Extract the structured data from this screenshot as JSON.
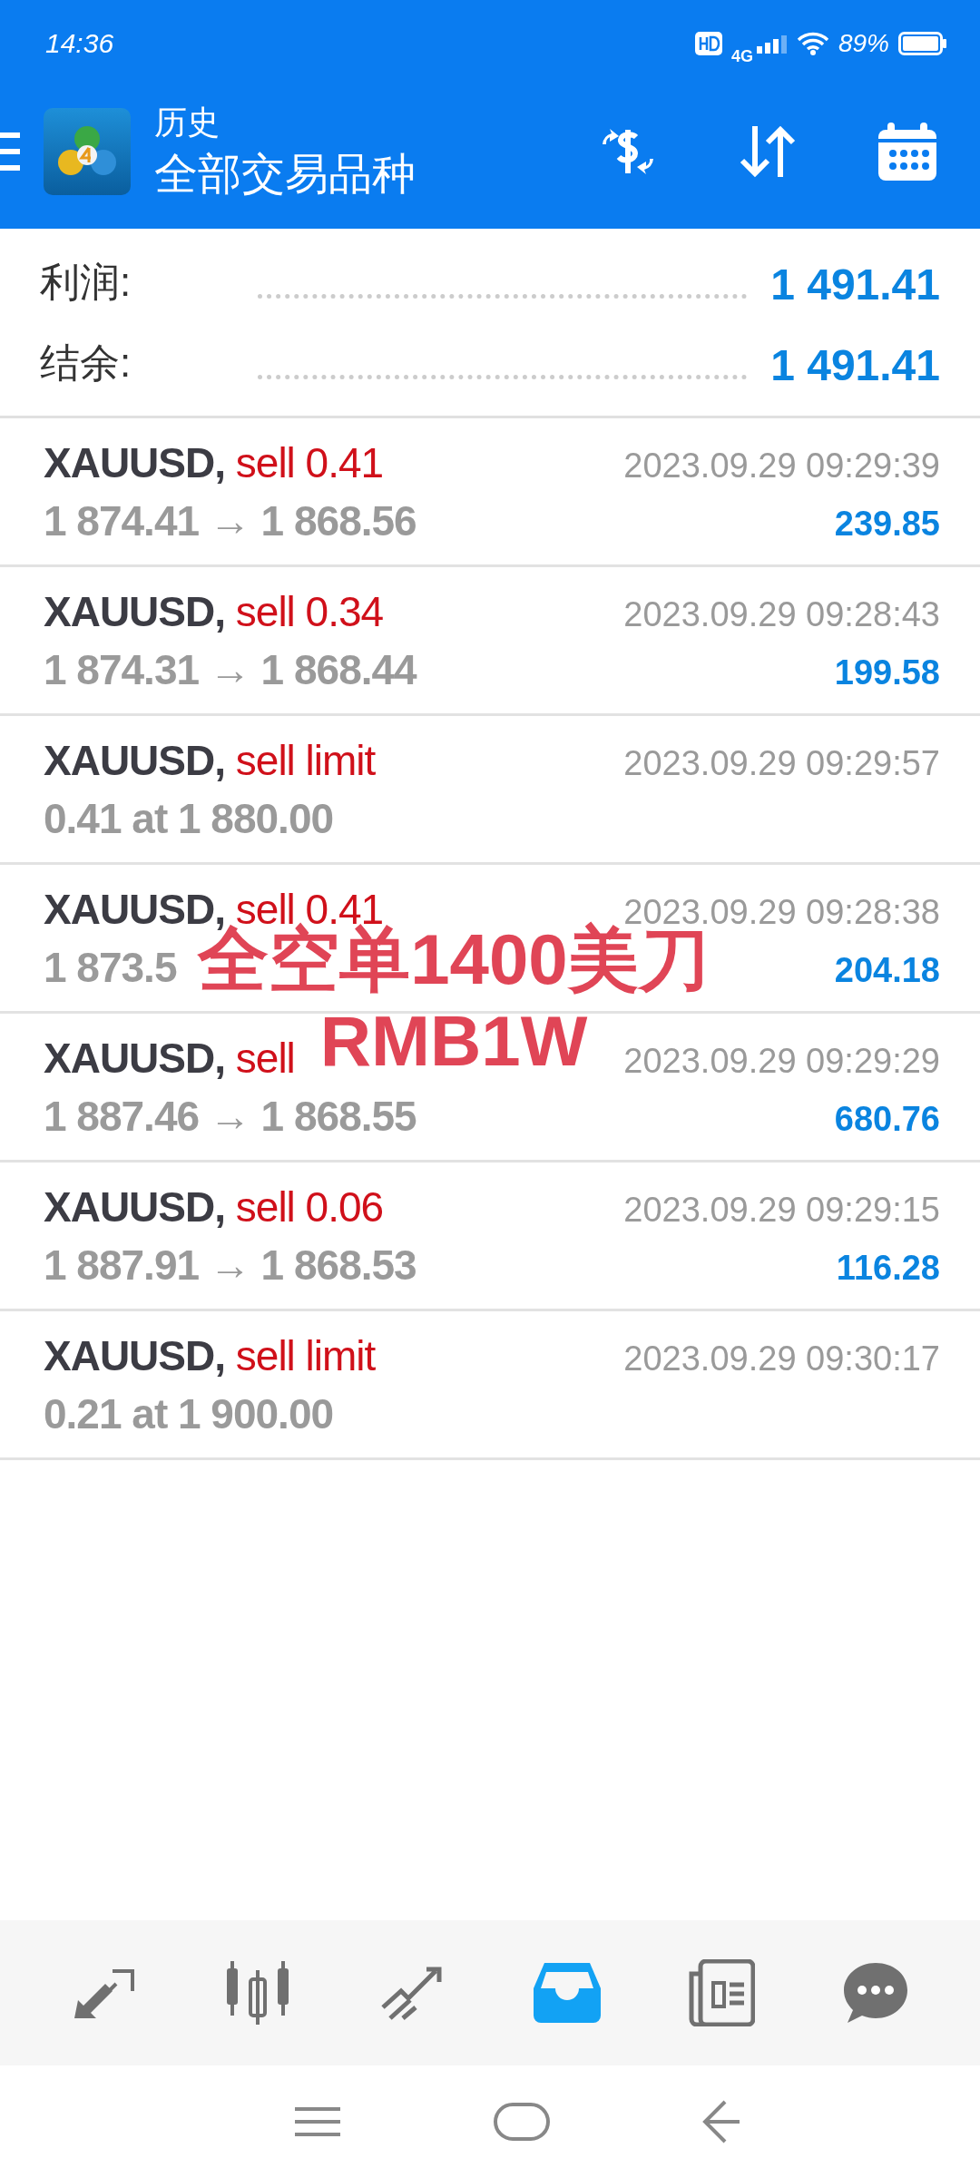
{
  "status_bar": {
    "time": "14:36",
    "network": "4G",
    "battery": "89%"
  },
  "header": {
    "title": "历史",
    "subtitle": "全部交易品种"
  },
  "summary": [
    {
      "label": "利润:",
      "value": "1 491.41"
    },
    {
      "label": "结余:",
      "value": "1 491.41"
    }
  ],
  "deals": [
    {
      "symbol": "XAUUSD,",
      "side": "sell 0.41",
      "time": "2023.09.29 09:29:39",
      "detail": "1 874.41 → 1 868.56",
      "profit": "239.85"
    },
    {
      "symbol": "XAUUSD,",
      "side": "sell 0.34",
      "time": "2023.09.29 09:28:43",
      "detail": "1 874.31 → 1 868.44",
      "profit": "199.58"
    },
    {
      "symbol": "XAUUSD,",
      "side": "sell limit",
      "time": "2023.09.29 09:29:57",
      "detail": "0.41 at 1 880.00"
    },
    {
      "symbol": "XAUUSD,",
      "side": "sell 0.41",
      "time": "2023.09.29 09:28:38",
      "detail": "1 873.5",
      "profit": "204.18"
    },
    {
      "symbol": "XAUUSD,",
      "side": "sell",
      "time": "2023.09.29 09:29:29",
      "detail": "1 887.46 → 1 868.55",
      "profit": "680.76"
    },
    {
      "symbol": "XAUUSD,",
      "side": "sell 0.06",
      "time": "2023.09.29 09:29:15",
      "detail": "1 887.91 → 1 868.53",
      "profit": "116.28"
    },
    {
      "symbol": "XAUUSD,",
      "side": "sell limit",
      "time": "2023.09.29 09:30:17",
      "detail": "0.21 at 1 900.00"
    }
  ],
  "overlay_caption": [
    "全空单1400美刀",
    "RMB1W"
  ],
  "bottom_nav": [
    {
      "selected": false
    },
    {
      "selected": false
    },
    {
      "selected": false
    },
    {
      "selected": true
    },
    {
      "selected": false
    },
    {
      "selected": false
    }
  ]
}
